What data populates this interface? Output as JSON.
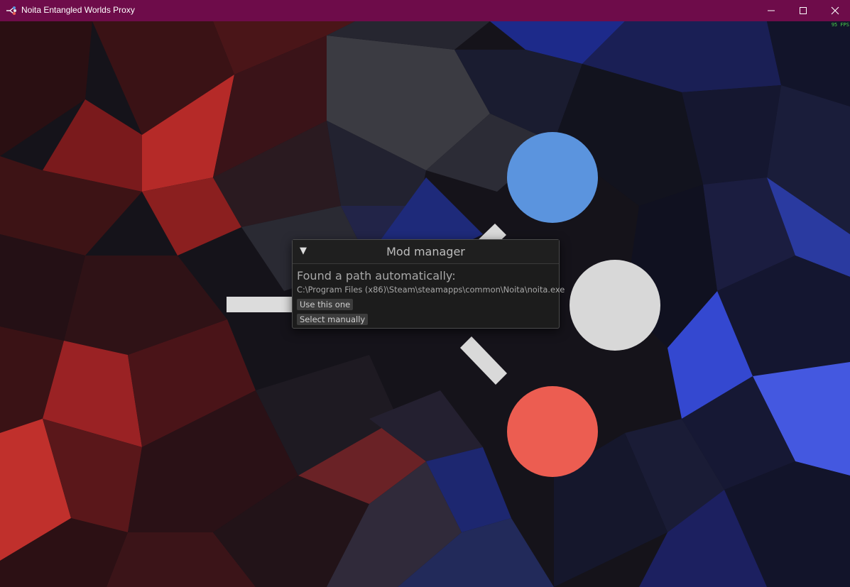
{
  "window": {
    "title": "Noita Entangled Worlds Proxy",
    "icon": "noita-app-icon",
    "controls": [
      "minimize-icon",
      "maximize-icon",
      "close-icon"
    ]
  },
  "overlay": {
    "fps": "95 FPS"
  },
  "mod_manager": {
    "title": "Mod manager",
    "found_label": "Found a path automatically:",
    "path": "C:\\Program Files (x86)\\Steam\\steamapps\\common\\Noita\\noita.exe",
    "use_button": "Use this one",
    "select_button": "Select manually"
  },
  "colors": {
    "titlebar": "#6e0c4a",
    "circle_blue": "#5b94de",
    "circle_white": "#d8d8d8",
    "circle_red": "#ec5d51",
    "panel_bg": "#1c1c1c",
    "fps_text": "#4cd14c"
  }
}
